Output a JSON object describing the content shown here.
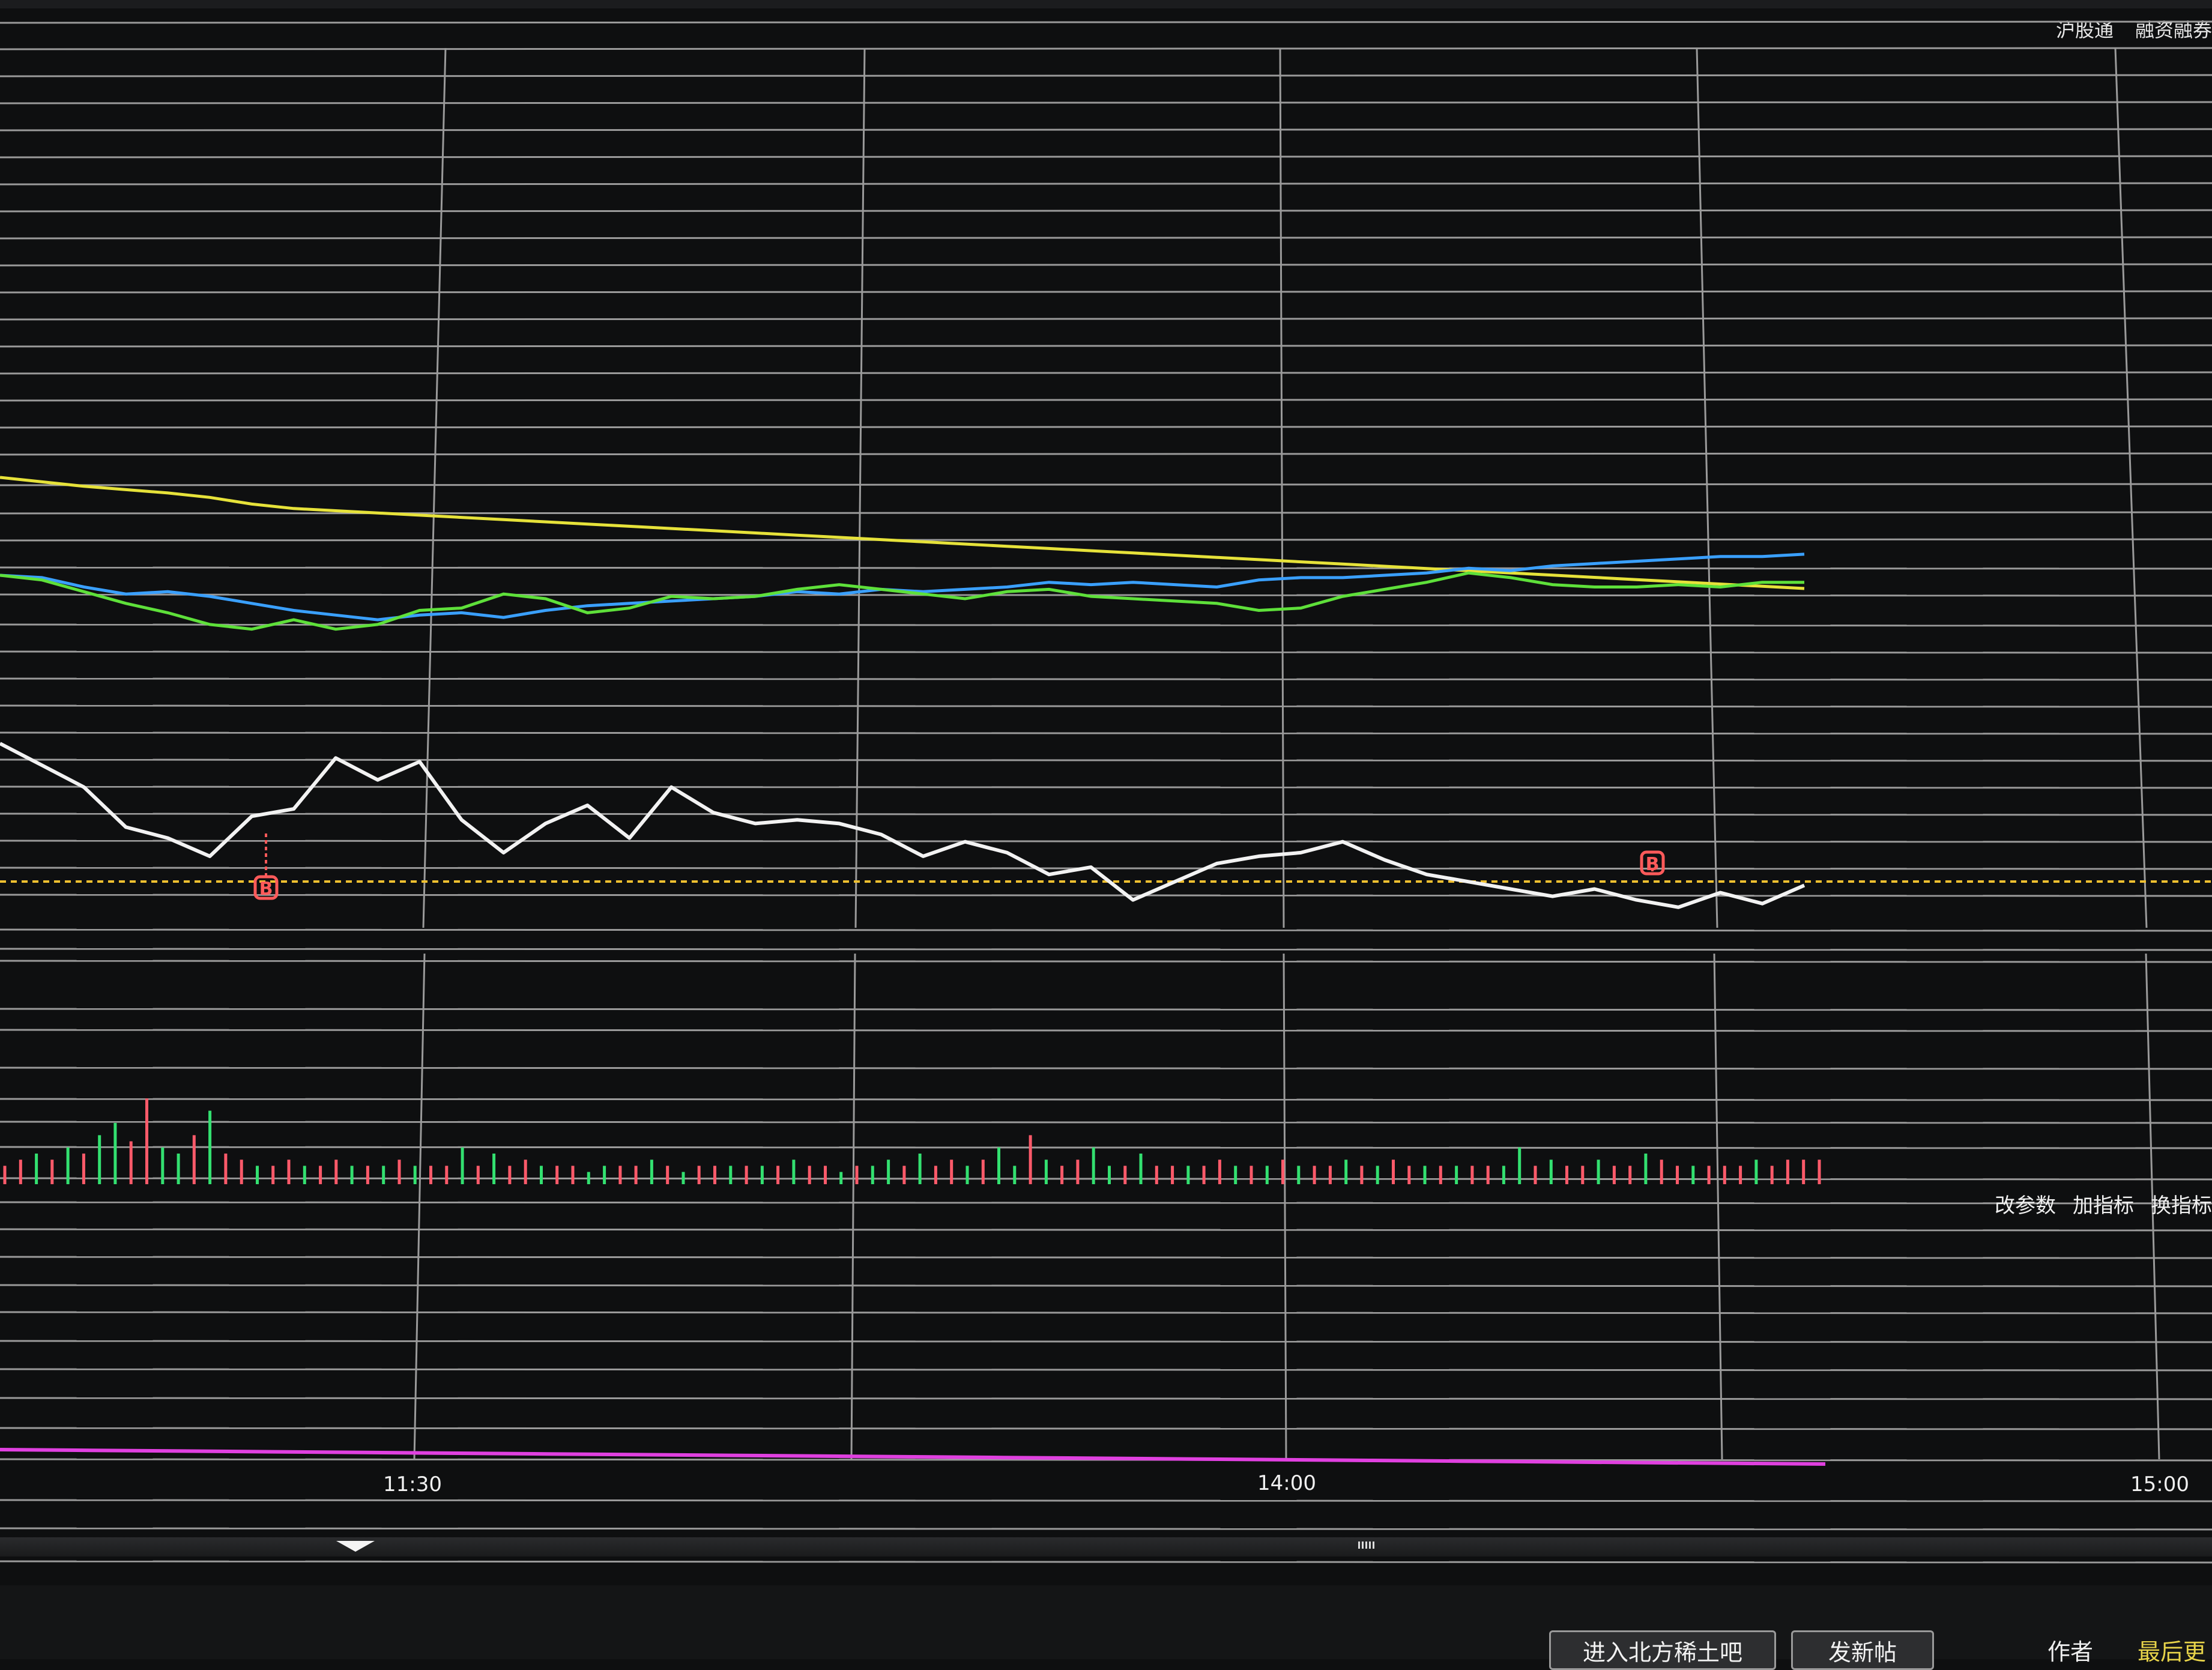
{
  "header": {
    "links": [
      "沪股通",
      "融资融券"
    ]
  },
  "indicator_links": [
    "改参数",
    "加指标",
    "换指标"
  ],
  "footer": {
    "enter_button": "进入北方稀土吧",
    "post_button": "发新帖",
    "author_label": "作者",
    "last_reply_label": "最后更"
  },
  "colors": {
    "background": "#0e0f10",
    "grid": "#9a9a9a",
    "ma_yellow": "#e6e23a",
    "ma_blue": "#3aa0ff",
    "ma_green": "#5ee03a",
    "price_line": "#f2f2f2",
    "ref_line": "#f0c030",
    "marker_red": "#ff5a5a",
    "volume_up": "#ff5a6a",
    "volume_down": "#33e070",
    "indicator_magenta": "#e040e0"
  },
  "chart_data": {
    "type": "line",
    "x_ticks": [
      "11:30",
      "14:00",
      "15:00"
    ],
    "price_panel": {
      "series": [
        {
          "values": [
            10,
            9.6,
            9.2,
            8.9,
            8.6,
            8.2,
            7.6,
            7.2,
            7.0,
            6.8,
            6.6,
            6.4,
            6.2,
            6.0,
            5.8,
            5.6,
            5.4,
            5.2,
            5.0,
            4.8,
            4.6,
            4.4,
            4.2,
            4.0,
            3.8,
            3.6,
            3.4,
            3.2,
            3.0,
            2.8,
            2.6,
            2.4,
            2.2,
            2.0,
            1.8,
            1.6,
            1.4,
            1.2,
            1.0,
            0.8,
            0.6,
            0.4,
            0.2,
            0.0
          ]
        },
        {
          "values": [
            6.0,
            5.8,
            5.0,
            4.4,
            4.6,
            4.2,
            3.6,
            3.0,
            2.6,
            2.2,
            2.6,
            2.8,
            2.4,
            3.0,
            3.4,
            3.6,
            3.8,
            4.0,
            4.2,
            4.6,
            4.4,
            4.8,
            4.6,
            4.8,
            5.0,
            5.4,
            5.2,
            5.4,
            5.2,
            5.0,
            5.6,
            5.8,
            5.8,
            6.0,
            6.2,
            6.6,
            6.4,
            6.8,
            7.0,
            7.2,
            7.4,
            7.6,
            7.6,
            7.8
          ]
        },
        {
          "values": [
            6.0,
            5.6,
            4.6,
            3.6,
            2.8,
            1.8,
            1.4,
            2.2,
            1.4,
            1.8,
            3.0,
            3.2,
            4.4,
            4.0,
            2.8,
            3.2,
            4.2,
            4.0,
            4.2,
            4.8,
            5.2,
            4.8,
            4.4,
            4.0,
            4.6,
            4.8,
            4.2,
            4.0,
            3.8,
            3.6,
            3.0,
            3.2,
            4.2,
            4.8,
            5.4,
            6.2,
            5.8,
            5.2,
            5.0,
            5.0,
            5.2,
            5.0,
            5.4,
            5.4
          ]
        },
        {
          "values": [
            9.8,
            8.6,
            7.4,
            5.2,
            4.6,
            3.6,
            5.8,
            6.2,
            9.0,
            7.8,
            8.8,
            5.6,
            3.8,
            5.4,
            6.4,
            4.6,
            7.4,
            6.0,
            5.4,
            5.6,
            5.4,
            4.8,
            3.6,
            4.4,
            3.8,
            2.6,
            3.0,
            1.2,
            2.2,
            3.2,
            3.6,
            3.8,
            4.4,
            3.4,
            2.6,
            2.2,
            1.8,
            1.4,
            1.8,
            1.2,
            0.8,
            1.6,
            1.0,
            2.0
          ]
        }
      ],
      "reference_line": "B",
      "markers": [
        "B",
        "B"
      ]
    },
    "volume_panel": {
      "values": [
        3,
        4,
        5,
        4,
        6,
        5,
        8,
        10,
        7,
        14,
        6,
        5,
        8,
        12,
        5,
        4,
        3,
        3,
        4,
        3,
        3,
        4,
        3,
        3,
        3,
        4,
        3,
        3,
        3,
        6,
        3,
        5,
        3,
        4,
        3,
        3,
        3,
        2,
        3,
        3,
        3,
        4,
        3,
        2,
        3,
        3,
        3,
        3,
        3,
        3,
        4,
        3,
        3,
        2,
        3,
        3,
        4,
        3,
        5,
        3,
        4,
        3,
        4,
        6,
        3,
        8,
        4,
        3,
        4,
        6,
        3,
        3,
        5,
        3,
        3,
        3,
        3,
        4,
        3,
        3,
        3,
        4,
        3,
        3,
        3,
        4,
        3,
        3,
        4,
        3,
        3,
        3,
        3,
        3,
        3,
        3,
        6,
        3,
        4,
        3,
        3,
        4,
        3,
        3,
        5,
        4,
        3,
        3,
        3,
        3,
        3,
        4,
        3,
        4,
        4,
        4
      ],
      "up": [
        1,
        1,
        0,
        1,
        0,
        1,
        0,
        0,
        1,
        1,
        0,
        0,
        1,
        0,
        1,
        1,
        0,
        1,
        1,
        0,
        1,
        1,
        0,
        1,
        0,
        1,
        0,
        1,
        1,
        0,
        1,
        0,
        1,
        1,
        0,
        1,
        1,
        0,
        0,
        1,
        1,
        0,
        1,
        0,
        1,
        1,
        0,
        1,
        0,
        1,
        0,
        1,
        1,
        0,
        1,
        0,
        0,
        1,
        0,
        1,
        1,
        0,
        1,
        0,
        0,
        1,
        0,
        1,
        1,
        0,
        0,
        1,
        0,
        1,
        1,
        0,
        1,
        1,
        0,
        1,
        0,
        1,
        0,
        1,
        1,
        0,
        1,
        0,
        1,
        1,
        0,
        1,
        0,
        1,
        1,
        0,
        0,
        1,
        0,
        1,
        1,
        0,
        1,
        1,
        0,
        1,
        1,
        0,
        1,
        1,
        1,
        0,
        1,
        1,
        1,
        1
      ]
    },
    "indicator_panel": {
      "values": [
        10,
        9.6,
        9.2,
        8.8,
        8.4,
        8.0,
        7.6,
        7.2,
        6.8,
        6.4,
        6.0,
        5.6,
        5.2,
        4.8,
        4.4,
        4.0,
        3.6,
        3.2,
        2.8,
        2.4,
        2.0
      ]
    }
  }
}
